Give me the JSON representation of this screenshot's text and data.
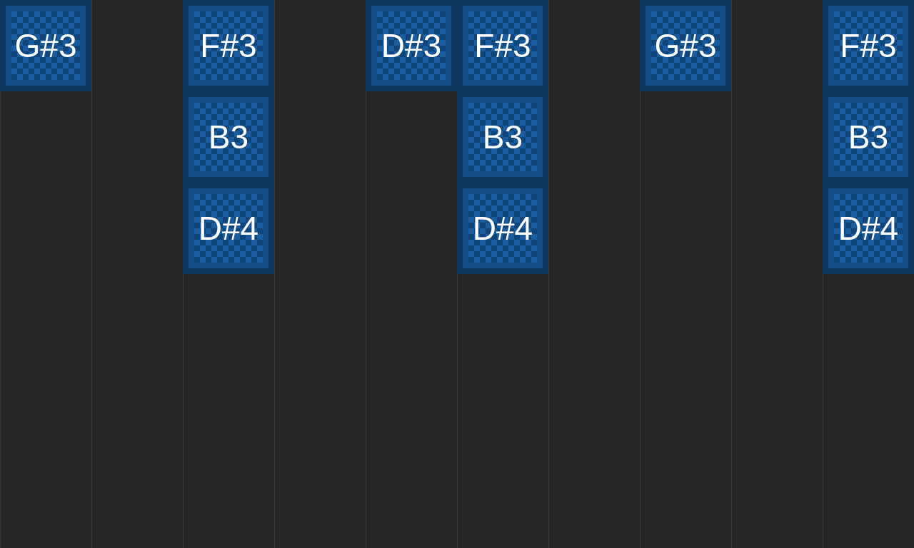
{
  "columns": [
    {
      "notes": [
        "G#3"
      ]
    },
    {},
    {
      "notes": [
        "F#3",
        "B3",
        "D#4"
      ]
    },
    {},
    {
      "notes": [
        "D#3"
      ]
    },
    {
      "notes": [
        "F#3",
        "B3",
        "D#4"
      ]
    },
    {},
    {
      "notes": [
        "G#3"
      ]
    },
    {},
    {
      "notes": [
        "F#3",
        "B3",
        "D#4"
      ]
    }
  ]
}
